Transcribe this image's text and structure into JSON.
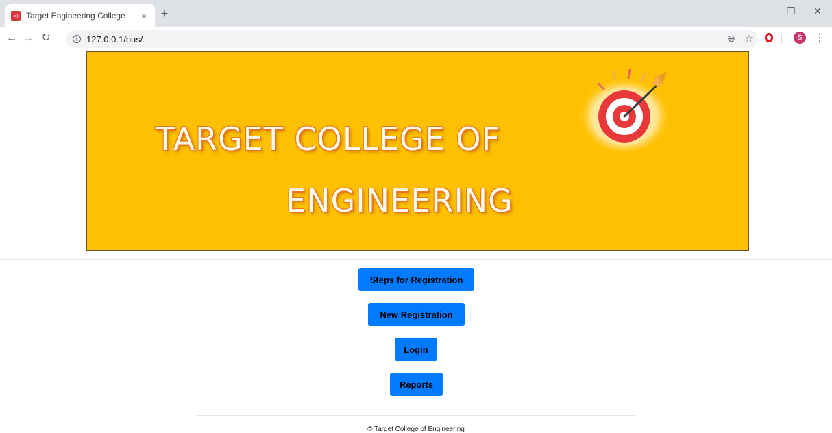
{
  "browser": {
    "tab_title": "Target Engineering College",
    "tab_close": "×",
    "new_tab": "+",
    "url": "127.0.0.1/bus/",
    "avatar_initial": "S",
    "icons": {
      "favicon": "target-favicon",
      "back": "back-arrow-icon",
      "forward": "forward-arrow-icon",
      "reload": "reload-icon",
      "info": "info-icon",
      "zoom": "zoom-icon",
      "bookmark": "star-icon",
      "opera": "opera-icon",
      "menu": "kebab-menu-icon",
      "minimize": "minimize-icon",
      "restore": "restore-icon",
      "close": "close-icon"
    }
  },
  "banner": {
    "line1": "TARGET COLLEGE OF",
    "line2": "ENGINEERING",
    "background_color": "#ffc001",
    "logo": "target-dartboard-logo"
  },
  "buttons": {
    "steps": "Steps for Registration",
    "new_registration": "New Registration",
    "login": "Login",
    "reports": "Reports",
    "color": "#007bff"
  },
  "footer": {
    "text": "© Target College of Engineering"
  }
}
